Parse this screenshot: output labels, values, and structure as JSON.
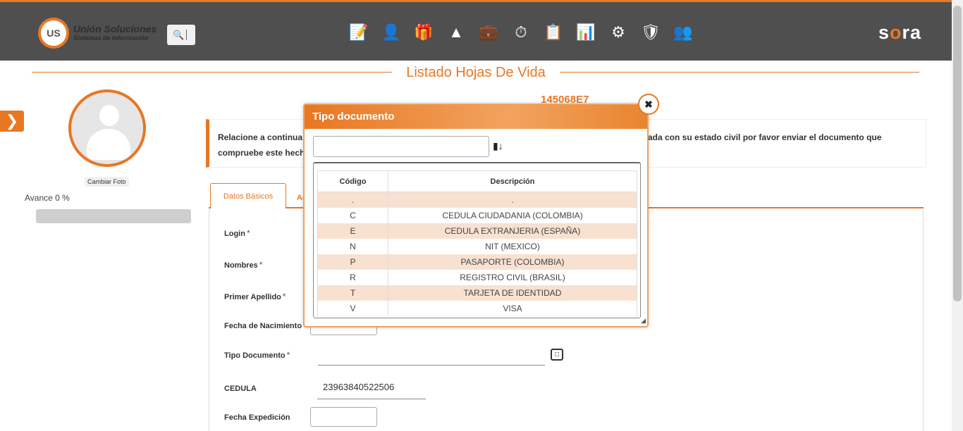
{
  "header": {
    "logo_mark": "US",
    "logo_title": "Unión Soluciones",
    "logo_subtitle": "Sistemas de Información",
    "brand_prefix": "s",
    "brand_accent": "o",
    "brand_suffix": "ra",
    "nav_icons": [
      "document-edit-icon",
      "person-key-icon",
      "gift-icon",
      "org-chart-icon",
      "profile-card-icon",
      "timer-icon",
      "form-list-icon",
      "presentation-icon",
      "gears-icon",
      "medical-shield-icon",
      "people-search-icon"
    ],
    "colors": {
      "bar": "#4f4f4f",
      "accent": "#e87722"
    }
  },
  "page": {
    "title": "Listado Hojas De Vida",
    "code": "145068E7",
    "info_text_line1": "Relacione a continua",
    "info_text_right": "ada con su estado civil por favor enviar el documento que",
    "info_text_line2": "compruebe este hech"
  },
  "sidebar": {
    "change_photo": "Cambiar Foto",
    "progress_label": "Avance 0 %",
    "progress_value": 0
  },
  "tabs": {
    "active": "Datos Básicos",
    "second_partial": "Ac"
  },
  "form": {
    "login_label": "Login",
    "nombres_label": "Nombres",
    "primer_apellido_label": "Primer Apellido",
    "fecha_nacimiento_label": "Fecha de Nacimiento",
    "tipo_documento_label": "Tipo Documento",
    "cedula_label": "CEDULA",
    "cedula_value": "23963840522506",
    "fecha_expedicion_label": "Fecha Expedición",
    "required_mark": "*"
  },
  "modal": {
    "title": "Tipo documento",
    "search_value": "",
    "columns": [
      "Código",
      "Descripción"
    ],
    "rows": [
      {
        "code": ".",
        "desc": "."
      },
      {
        "code": "C",
        "desc": "CEDULA CIUDADANIA (COLOMBIA)"
      },
      {
        "code": "E",
        "desc": "CEDULA EXTRANJERIA (ESPAÑA)"
      },
      {
        "code": "N",
        "desc": "NIT (MEXICO)"
      },
      {
        "code": "P",
        "desc": "PASAPORTE (COLOMBIA)"
      },
      {
        "code": "R",
        "desc": "REGISTRO CIVIL (BRASIL)"
      },
      {
        "code": "T",
        "desc": "TARJETA DE IDENTIDAD"
      },
      {
        "code": "V",
        "desc": "VISA"
      }
    ]
  }
}
